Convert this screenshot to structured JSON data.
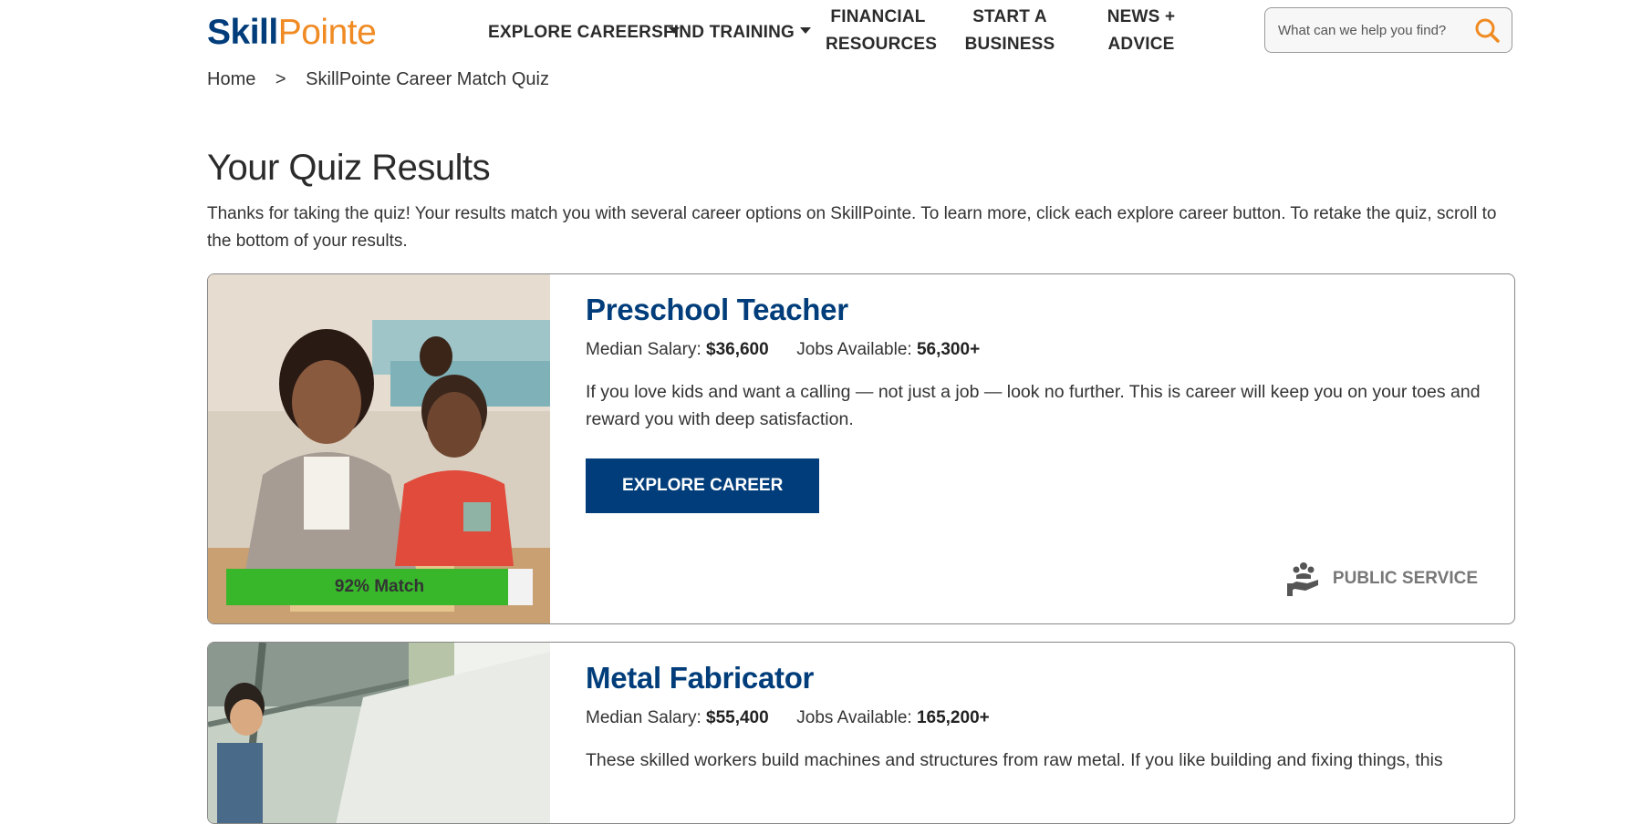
{
  "header": {
    "logo_part1": "Skill",
    "logo_part2": "Pointe",
    "nav": [
      {
        "label": "EXPLORE CAREERS",
        "has_dropdown": true
      },
      {
        "label": "FIND TRAINING",
        "has_dropdown": true
      },
      {
        "label_line1": "FINANCIAL",
        "label_line2": "RESOURCES"
      },
      {
        "label_line1": "START A",
        "label_line2": "BUSINESS"
      },
      {
        "label_line1": "NEWS +",
        "label_line2": "ADVICE"
      }
    ],
    "search": {
      "placeholder": "What can we help you find?",
      "icon": "search-icon"
    }
  },
  "breadcrumb": {
    "home": "Home",
    "separator": ">",
    "current": "SkillPointe Career Match Quiz"
  },
  "page": {
    "title": "Your Quiz Results",
    "intro": "Thanks for taking the quiz! Your results match you with several career options on SkillPointe. To learn more, click each explore career button. To retake the quiz, scroll to the bottom of your results."
  },
  "results": [
    {
      "title": "Preschool Teacher",
      "salary_label": "Median Salary:",
      "salary": "$36,600",
      "jobs_label": "Jobs Available:",
      "jobs": "56,300+",
      "description": "If you love kids and want a calling — not just a job — look no further. This is career will keep you on your toes and reward you with deep satisfaction.",
      "button": "EXPLORE CAREER",
      "match_label": "92% Match",
      "match_percent": 92,
      "category": "PUBLIC SERVICE",
      "category_icon": "public-service-icon"
    },
    {
      "title": "Metal Fabricator",
      "salary_label": "Median Salary:",
      "salary": "$55,400",
      "jobs_label": "Jobs Available:",
      "jobs": "165,200+",
      "description": "These skilled workers build machines and structures from raw metal. If you like building and fixing things, this"
    }
  ],
  "colors": {
    "brand_blue": "#003d7a",
    "brand_orange": "#f08a22",
    "match_green": "#38b72b"
  }
}
